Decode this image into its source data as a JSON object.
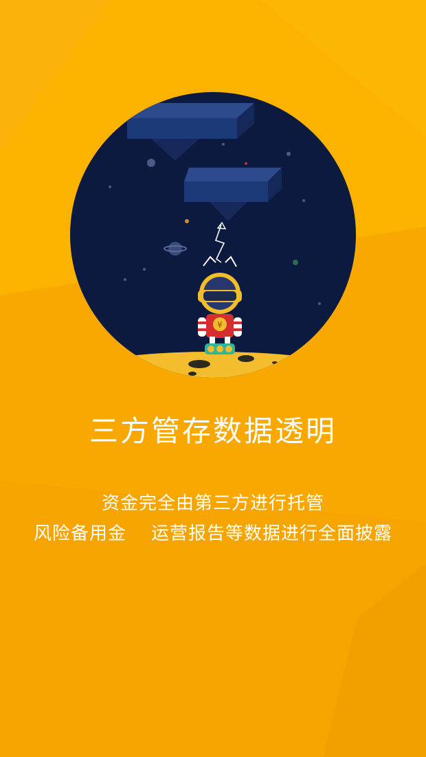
{
  "screen": {
    "background_color": "#f9ad00",
    "accent_dark": "#0d1a3f"
  },
  "illustration": {
    "name": "astronaut-robot-on-moon-illustration"
  },
  "title": "三方管存数据透明",
  "description": {
    "line1": "资金完全由第三方进行托管",
    "line2_part1": "风险备用金",
    "line2_part2": "运营报告等数据进行全面披露"
  }
}
